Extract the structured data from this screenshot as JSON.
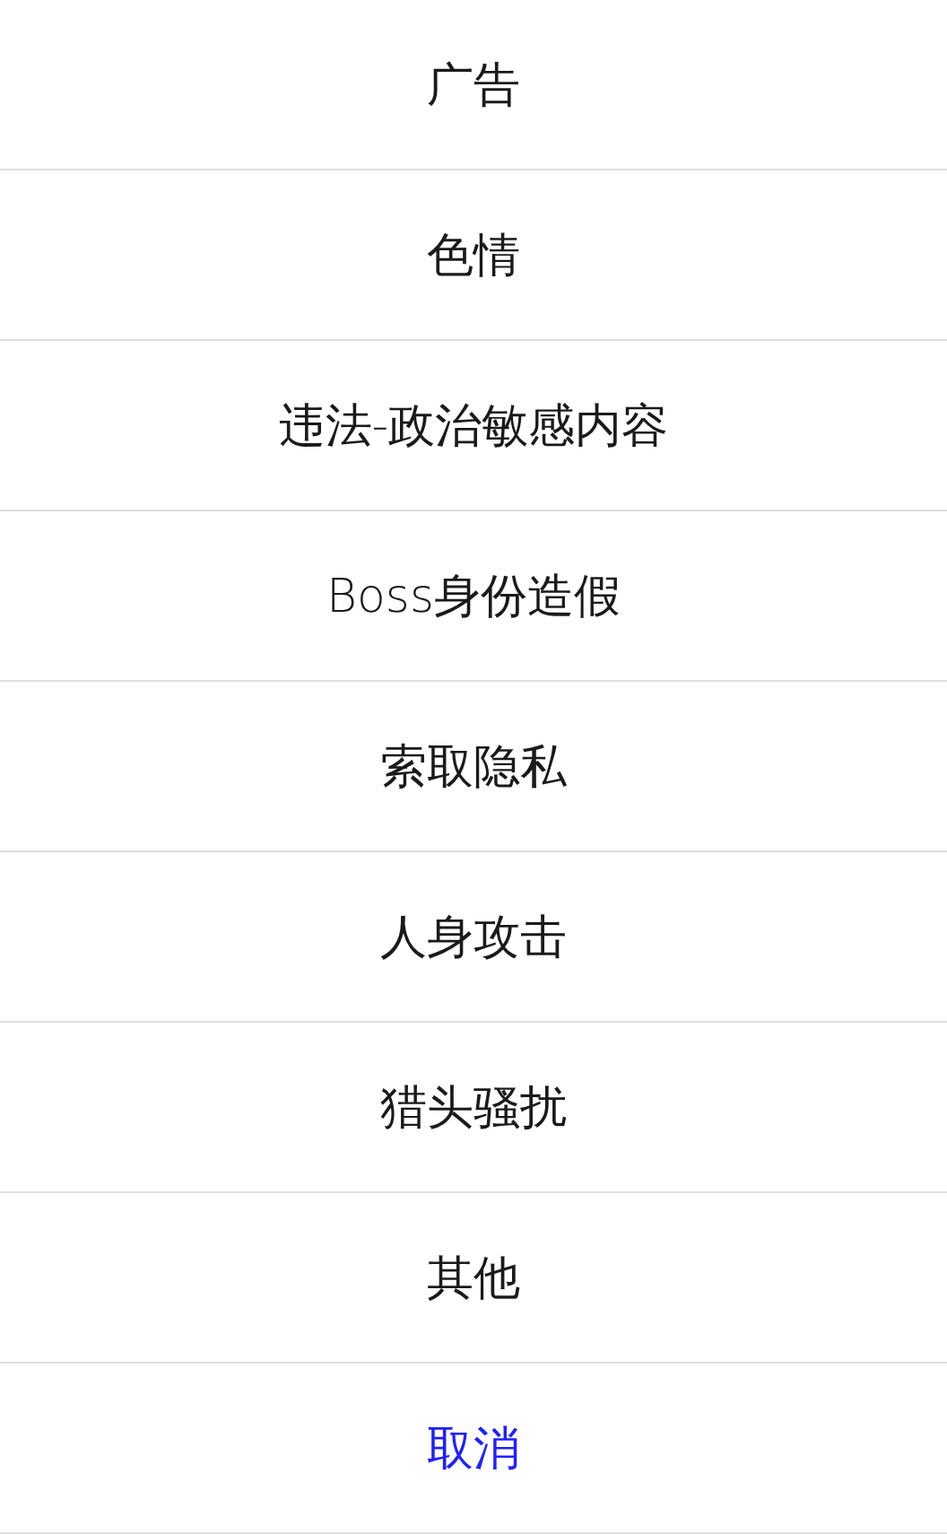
{
  "action_sheet": {
    "items": [
      {
        "label": "广告",
        "kind": "option"
      },
      {
        "label": "色情",
        "kind": "option"
      },
      {
        "label": "违法-政治敏感内容",
        "kind": "option"
      },
      {
        "label": "Boss身份造假",
        "kind": "option"
      },
      {
        "label": "索取隐私",
        "kind": "option"
      },
      {
        "label": "人身攻击",
        "kind": "option"
      },
      {
        "label": "猎头骚扰",
        "kind": "option"
      },
      {
        "label": "其他",
        "kind": "option"
      },
      {
        "label": "取消",
        "kind": "cancel"
      }
    ]
  }
}
